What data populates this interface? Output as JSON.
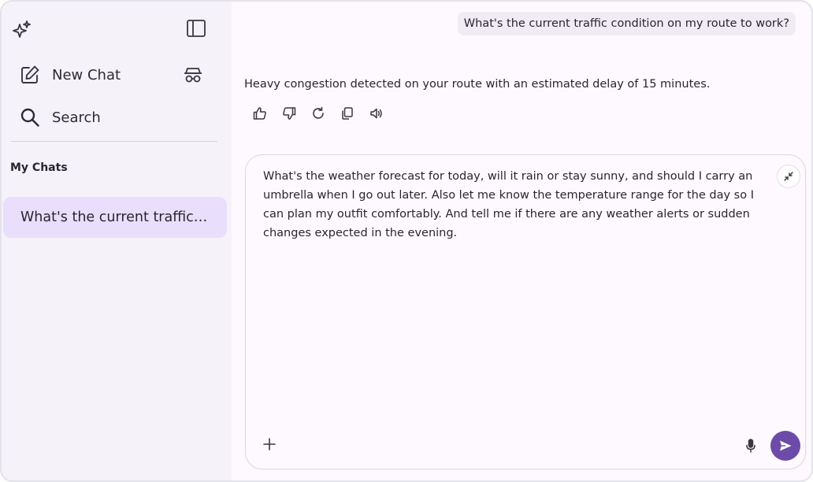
{
  "sidebar": {
    "new_chat_label": "New Chat",
    "search_label": "Search",
    "section_title": "My Chats",
    "chats": [
      {
        "title": "What's the current traffic condition on my route to work?"
      }
    ]
  },
  "conversation": {
    "user_message": "What's the current traffic condition on my route to work?",
    "assistant_message": "Heavy congestion detected on your route with an estimated delay of 15 minutes."
  },
  "composer": {
    "text": "What's the weather forecast for today, will it rain or stay sunny, and should I carry an umbrella when I go out later. Also let me know the temperature range for the day so I can plan my outfit comfortably. And tell me if there are any weather alerts or sudden changes expected in the evening."
  },
  "colors": {
    "accent": "#6c4ca8",
    "selected_chat_bg": "#e9defb",
    "sidebar_bg": "#f6f2f9"
  },
  "icons": {
    "logo": "sparkles-icon",
    "sidebar_toggle": "sidebar-panel-icon",
    "new_chat": "edit-square-icon",
    "incognito": "incognito-icon",
    "search": "search-icon",
    "like": "thumbs-up-icon",
    "dislike": "thumbs-down-icon",
    "regenerate": "refresh-icon",
    "copy": "copy-icon",
    "read_aloud": "speaker-icon",
    "collapse": "collapse-icon",
    "attach": "plus-icon",
    "mic": "mic-icon",
    "send": "send-icon"
  }
}
